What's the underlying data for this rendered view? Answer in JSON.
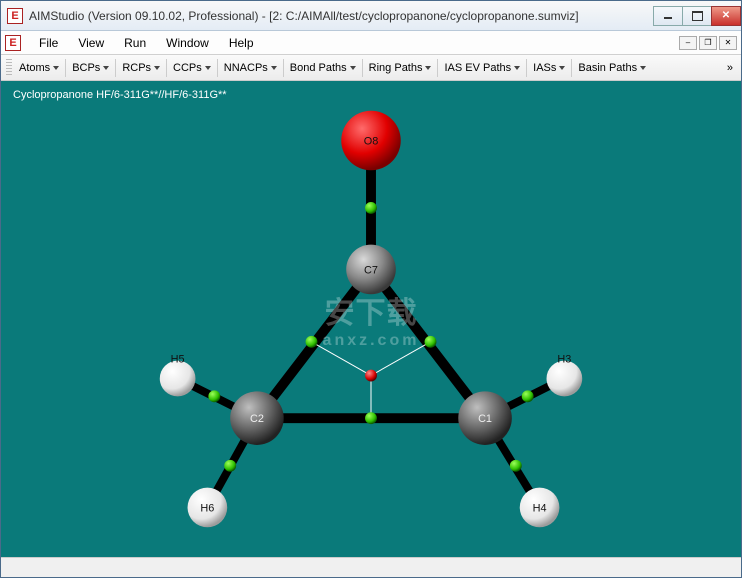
{
  "window": {
    "title": "AIMStudio (Version 09.10.02, Professional) - [2:  C:/AIMAll/test/cyclopropanone/cyclopropanone.sumviz]"
  },
  "menu": {
    "file": "File",
    "view": "View",
    "run": "Run",
    "window": "Window",
    "help": "Help"
  },
  "toolbar": {
    "atoms": "Atoms",
    "bcps": "BCPs",
    "rcps": "RCPs",
    "ccps": "CCPs",
    "nnacps": "NNACPs",
    "bondpaths": "Bond Paths",
    "ringpaths": "Ring Paths",
    "iasev": "IAS EV Paths",
    "iass": "IASs",
    "basinpaths": "Basin Paths",
    "overflow": "»"
  },
  "viewer": {
    "caption": "Cyclopropanone HF/6-311G**//HF/6-311G**"
  },
  "atoms": {
    "o8": "O8",
    "c7": "C7",
    "c1": "C1",
    "c2": "C2",
    "h3": "H3",
    "h4": "H4",
    "h5": "H5",
    "h6": "H6"
  },
  "watermark": {
    "big": "安下载",
    "small": "anxz.com"
  }
}
